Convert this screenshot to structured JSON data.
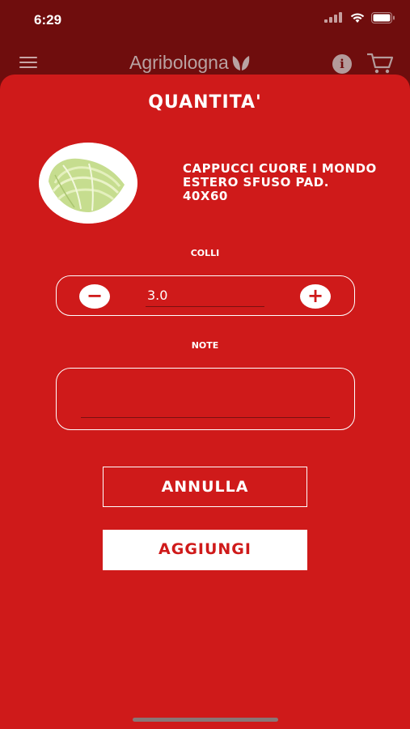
{
  "status_bar": {
    "time": "6:29"
  },
  "header": {
    "brand": "Agribologna"
  },
  "dialog": {
    "title": "QUANTITA'",
    "product_name": "CAPPUCCI CUORE I MONDO ESTERO SFUSO PAD. 40X60",
    "quantity_label": "COLLI",
    "quantity_value": "3.0",
    "minus_symbol": "−",
    "plus_symbol": "+",
    "note_label": "NOTE",
    "note_value": "",
    "cancel_label": "ANNULLA",
    "add_label": "AGGIUNGI"
  },
  "colors": {
    "sheet": "#cf1a1a",
    "background": "#6f0d0d"
  }
}
